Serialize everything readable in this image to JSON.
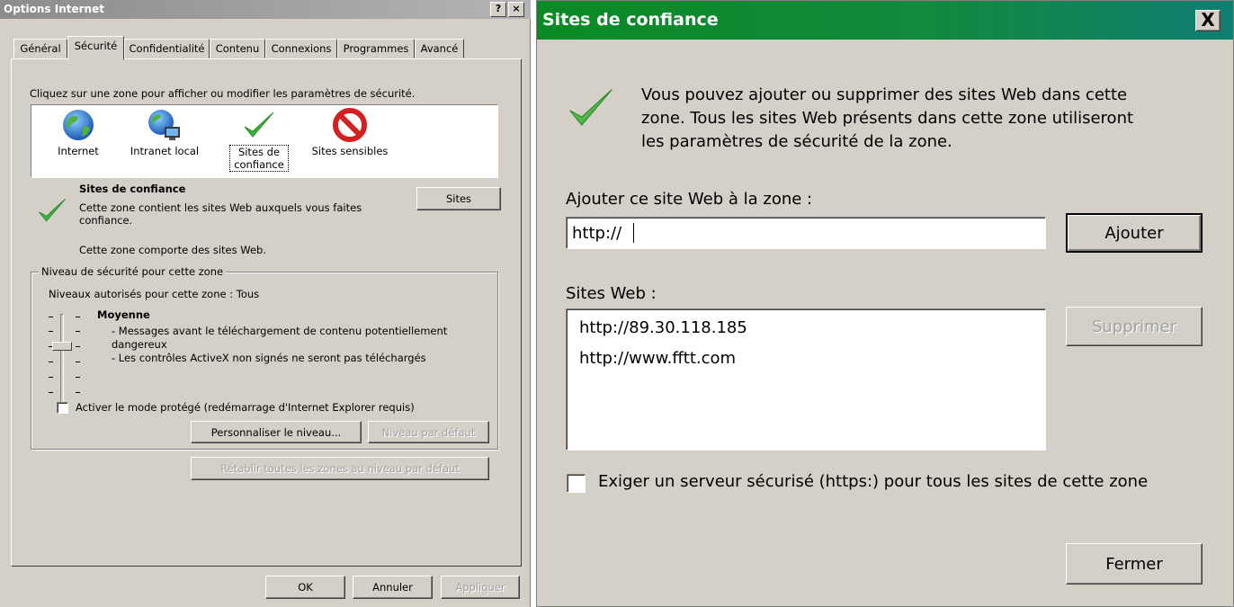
{
  "options_dialog": {
    "title": "Options Internet",
    "help_button": "?",
    "close_button": "×",
    "tabs": [
      "Général",
      "Sécurité",
      "Confidentialité",
      "Contenu",
      "Connexions",
      "Programmes",
      "Avancé"
    ],
    "active_tab": "Sécurité",
    "zone_prompt": "Cliquez sur une zone pour afficher ou modifier les paramètres de sécurité.",
    "zones": [
      {
        "label": "Internet",
        "icon": "globe-icon"
      },
      {
        "label": "Intranet local",
        "icon": "intranet-icon"
      },
      {
        "label_line1": "Sites de",
        "label_line2": "confiance",
        "icon": "checkmark-icon",
        "selected": true
      },
      {
        "label": "Sites sensibles",
        "icon": "restricted-icon"
      }
    ],
    "zone_title": "Sites de confiance",
    "zone_desc_line1": "Cette zone contient les sites Web auxquels vous faites",
    "zone_desc_line2": "confiance.",
    "zone_has_sites": "Cette zone comporte des sites Web.",
    "sites_button": "Sites",
    "security_group_label": "Niveau de sécurité pour cette zone",
    "allowed_levels": "Niveaux autorisés pour cette zone : Tous",
    "level_name": "Moyenne",
    "level_desc_line1": "- Messages avant le téléchargement de contenu potentiellement",
    "level_desc_line2": "dangereux",
    "level_desc_line3": "- Les contrôles ActiveX non signés ne seront pas téléchargés",
    "protected_mode_label": "Activer le mode protégé (redémarrage d'Internet Explorer requis)",
    "protected_mode_checked": false,
    "custom_level_button": "Personnaliser le niveau...",
    "default_level_button": "Niveau par défaut",
    "reset_all_button": "Rétablir toutes les zones au niveau par défaut",
    "ok_button": "OK",
    "cancel_button": "Annuler",
    "apply_button": "Appliquer"
  },
  "trusted_sites_dialog": {
    "title": "Sites de confiance",
    "close_button": "X",
    "intro_line1": "Vous pouvez ajouter ou supprimer des sites Web dans cette",
    "intro_line2": "zone. Tous les sites Web présents dans cette zone utiliseront",
    "intro_line3": "les paramètres de sécurité de la zone.",
    "add_label": "Ajouter ce site Web à la zone :",
    "add_input_value": "http://",
    "add_button": "Ajouter",
    "sites_label": "Sites Web :",
    "sites": [
      "http://89.30.118.185",
      "http://www.fftt.com"
    ],
    "remove_button": "Supprimer",
    "https_label": "Exiger un serveur sécurisé (https:) pour tous les sites de cette zone",
    "https_checked": false,
    "close_label": "Fermer"
  },
  "colors": {
    "dialog_bg": "#d4d0c8",
    "trusted_title_green": "#108a3c",
    "check_green": "#3cb43c",
    "restricted_red": "#d42020",
    "globe_blue": "#2a6fc9"
  }
}
